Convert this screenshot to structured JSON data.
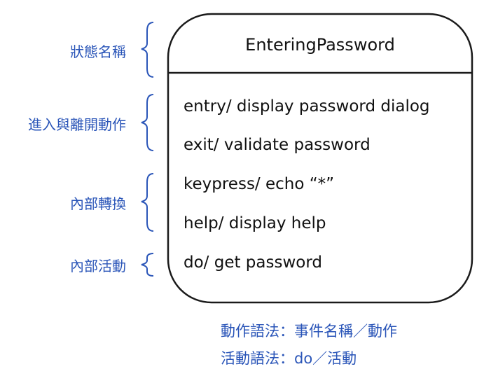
{
  "colors": {
    "annotation": "#2a55b8",
    "box_stroke": "#1a1a1a",
    "text": "#111111"
  },
  "state": {
    "name": "EnteringPassword",
    "actions": {
      "entry": "entry/ display password dialog",
      "exit": "exit/ validate password",
      "keypress": "keypress/ echo “*”",
      "help": "help/ display help",
      "do": "do/ get password"
    }
  },
  "annotations": {
    "state_name": "狀態名稱",
    "entry_exit": "進入與離開動作",
    "internal_transition": "內部轉換",
    "internal_activity": "內部活動"
  },
  "notes": {
    "action_syntax": "動作語法：事件名稱／動作",
    "activity_syntax": "活動語法：do／活動"
  }
}
